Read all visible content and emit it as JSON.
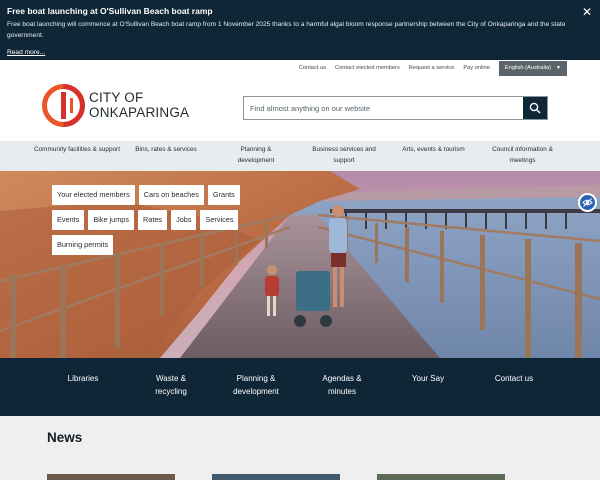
{
  "alert": {
    "title": "Free boat launching at O'Sullivan Beach boat ramp",
    "body": "Free boat launching will commence at O'Sullivan Beach boat ramp from 1 November 2025 thanks to a harmful algal bloom response partnership between the City of Onkaparinga and the state government.",
    "link": "Read more..."
  },
  "utility": {
    "links": [
      "Contact us",
      "Contact elected members",
      "Request a service",
      "Pay online"
    ],
    "language": "English (Australia)"
  },
  "logo": {
    "line1": "CITY OF",
    "line2": "ONKAPARINGA"
  },
  "search": {
    "placeholder": "Find almost anything on our website"
  },
  "nav": {
    "items": [
      {
        "label": "Community facilities & support"
      },
      {
        "label": "Bins, rates & services"
      },
      {
        "label": "Planning & development"
      },
      {
        "label": "Business services and support"
      },
      {
        "label": "Arts, events & tourism"
      },
      {
        "label": "Council information & meetings"
      }
    ]
  },
  "quick_links": [
    "Your elected members",
    "Cars on beaches",
    "Grants",
    "Events",
    "Bike jumps",
    "Rates",
    "Jobs",
    "Services",
    "Burning permits"
  ],
  "services": [
    {
      "line1": "Libraries",
      "line2": ""
    },
    {
      "line1": "Waste &",
      "line2": "recycling"
    },
    {
      "line1": "Planning &",
      "line2": "development"
    },
    {
      "line1": "Agendas &",
      "line2": "minutes"
    },
    {
      "line1": "Your Say",
      "line2": ""
    },
    {
      "line1": "Contact us",
      "line2": ""
    }
  ],
  "news": {
    "title": "News"
  },
  "colors": {
    "navy": "#0f2636",
    "logo_orange": "#e8562a",
    "logo_red": "#d5302b",
    "nav_bg": "#e9ecee",
    "accessibility_blue": "#2a63b6"
  }
}
